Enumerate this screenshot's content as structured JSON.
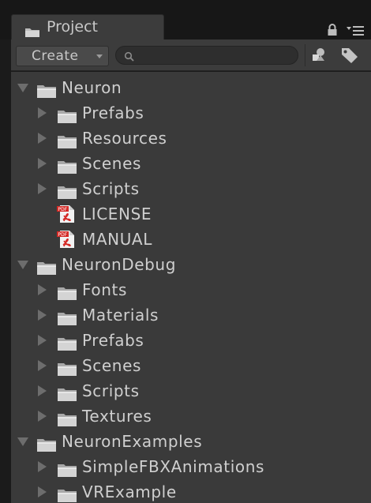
{
  "window": {
    "tab_title": "Project",
    "tab_icon": "folder-icon",
    "header_icons": [
      "lock-icon",
      "menu-icon"
    ]
  },
  "toolbar": {
    "create_label": "Create",
    "search_placeholder": "",
    "search_value": "",
    "icons": [
      "search-icon",
      "filter-by-type-icon",
      "filter-by-label-icon"
    ]
  },
  "colors": {
    "panel_bg": "#3a3a3a",
    "text": "#cfcfcf",
    "window_bg": "#1b1b1b",
    "pdf_red": "#d42a26"
  },
  "tree": {
    "items": [
      {
        "label": "Neuron",
        "type": "folder",
        "depth": 0,
        "expanded": true
      },
      {
        "label": "Prefabs",
        "type": "folder",
        "depth": 1,
        "expanded": false
      },
      {
        "label": "Resources",
        "type": "folder",
        "depth": 1,
        "expanded": false
      },
      {
        "label": "Scenes",
        "type": "folder",
        "depth": 1,
        "expanded": false
      },
      {
        "label": "Scripts",
        "type": "folder",
        "depth": 1,
        "expanded": false
      },
      {
        "label": "LICENSE",
        "type": "pdf",
        "depth": 1,
        "icon_text": "PDF"
      },
      {
        "label": "MANUAL",
        "type": "pdf",
        "depth": 1,
        "icon_text": "PDF"
      },
      {
        "label": "NeuronDebug",
        "type": "folder",
        "depth": 0,
        "expanded": true
      },
      {
        "label": "Fonts",
        "type": "folder",
        "depth": 1,
        "expanded": false
      },
      {
        "label": "Materials",
        "type": "folder",
        "depth": 1,
        "expanded": false
      },
      {
        "label": "Prefabs",
        "type": "folder",
        "depth": 1,
        "expanded": false
      },
      {
        "label": "Scenes",
        "type": "folder",
        "depth": 1,
        "expanded": false
      },
      {
        "label": "Scripts",
        "type": "folder",
        "depth": 1,
        "expanded": false
      },
      {
        "label": "Textures",
        "type": "folder",
        "depth": 1,
        "expanded": false
      },
      {
        "label": "NeuronExamples",
        "type": "folder",
        "depth": 0,
        "expanded": true
      },
      {
        "label": "SimpleFBXAnimations",
        "type": "folder",
        "depth": 1,
        "expanded": false
      },
      {
        "label": "VRExample",
        "type": "folder",
        "depth": 1,
        "expanded": false
      }
    ]
  }
}
